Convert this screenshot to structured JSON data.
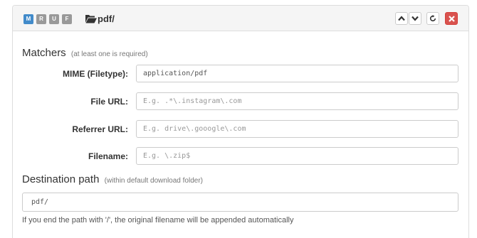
{
  "header": {
    "flags": [
      "M",
      "R",
      "U",
      "F"
    ],
    "folder_name": "pdf/"
  },
  "matchers": {
    "title": "Matchers",
    "hint": "(at least one is required)",
    "rows": [
      {
        "label": "MIME (Filetype):",
        "value": "application/pdf",
        "placeholder": ""
      },
      {
        "label": "File URL:",
        "value": "",
        "placeholder": "E.g. .*\\.instagram\\.com"
      },
      {
        "label": "Referrer URL:",
        "value": "",
        "placeholder": "E.g. drive\\.gooogle\\.com"
      },
      {
        "label": "Filename:",
        "value": "",
        "placeholder": "E.g. \\.zip$"
      }
    ]
  },
  "destination": {
    "title": "Destination path",
    "hint": "(within default download folder)",
    "value": "pdf/",
    "help": "If you end the path with '/', the original filename will be appended automatically"
  },
  "colors": {
    "flag_active": "#428bca",
    "flag_inactive": "#999999",
    "delete_button": "#d9534f"
  }
}
